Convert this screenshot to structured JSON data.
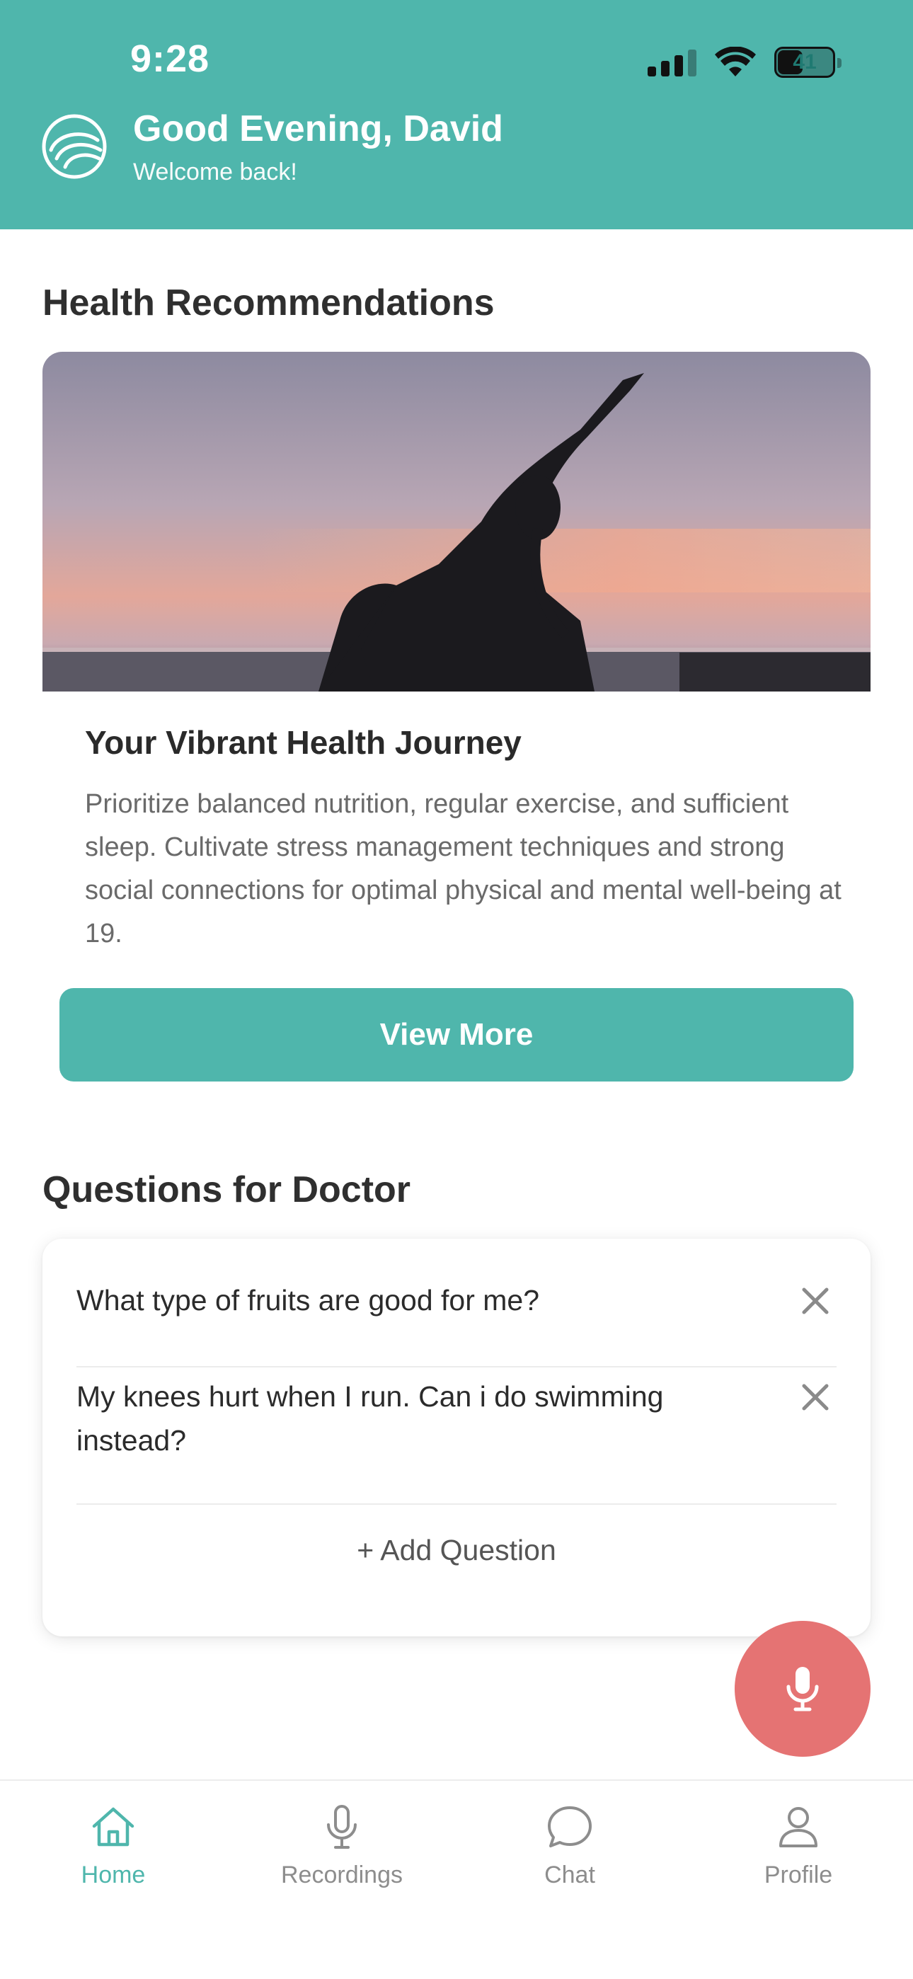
{
  "status_bar": {
    "time": "9:28",
    "battery": "41"
  },
  "header": {
    "greeting": "Good Evening, David",
    "subtitle": "Welcome back!"
  },
  "recommendations": {
    "section_title": "Health Recommendations",
    "card_title": "Your Vibrant Health Journey",
    "card_body": "Prioritize balanced nutrition, regular exercise, and sufficient sleep. Cultivate stress management techniques and strong social connections for optimal physical and mental well-being at 19.",
    "button_label": "View More"
  },
  "questions": {
    "section_title": "Questions for Doctor",
    "items": [
      {
        "text": "What type of fruits are good for me?"
      },
      {
        "text": "My knees hurt when I run. Can i do swimming instead?"
      }
    ],
    "add_label": "+ Add Question"
  },
  "tabs": [
    {
      "label": "Home",
      "icon": "home-icon",
      "active": true
    },
    {
      "label": "Recordings",
      "icon": "microphone-icon",
      "active": false
    },
    {
      "label": "Chat",
      "icon": "chat-bubble-icon",
      "active": false
    },
    {
      "label": "Profile",
      "icon": "person-icon",
      "active": false
    }
  ],
  "colors": {
    "primary": "#4fb6ac",
    "mic_button": "#e57373",
    "text_dark": "#2b2b2b",
    "text_muted": "#6a6a6a"
  }
}
